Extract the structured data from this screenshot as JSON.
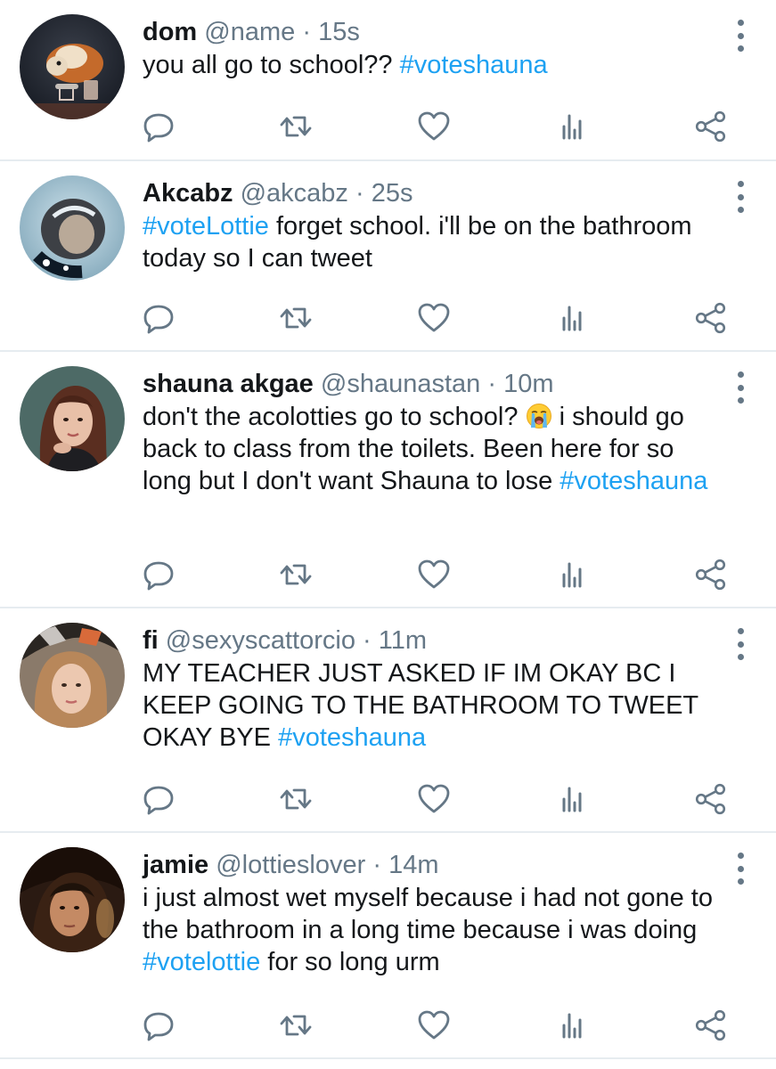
{
  "tweets": [
    {
      "name": "dom",
      "handle": "@name",
      "time": "15s",
      "avatar_icon": "avatar-guinea-pig-painting",
      "segments": [
        {
          "text": "you all go to school?? ",
          "tag": false
        },
        {
          "text": "#voteshauna",
          "tag": true
        }
      ]
    },
    {
      "name": "Akcabz",
      "handle": "@akcabz",
      "time": "25s",
      "avatar_icon": "avatar-penguin-art",
      "segments": [
        {
          "text": "#voteLottie",
          "tag": true
        },
        {
          "text": " forget school. i'll be on the bathroom today so I can tweet",
          "tag": false
        }
      ]
    },
    {
      "name": "shauna akgae",
      "handle": "@shaunastan",
      "time": "10m",
      "avatar_icon": "avatar-portrait-woman",
      "segments": [
        {
          "text": "don't the acolotties go to school? ",
          "tag": false
        },
        {
          "emoji": "loudly-crying-face-emoji"
        },
        {
          "text": " i should go back to class from the toilets. Been here for so long but I don't want Shauna to lose ",
          "tag": false
        },
        {
          "text": "#voteshauna",
          "tag": true
        }
      ]
    },
    {
      "name": "fi",
      "handle": "@sexyscattorcio",
      "time": "11m",
      "avatar_icon": "avatar-portrait-girl",
      "segments": [
        {
          "text": "MY TEACHER JUST ASKED IF IM OKAY BC I KEEP GOING TO THE BATHROOM TO TWEET OKAY BYE ",
          "tag": false
        },
        {
          "text": "#voteshauna",
          "tag": true
        }
      ]
    },
    {
      "name": "jamie",
      "handle": "@lottieslover",
      "time": "14m",
      "avatar_icon": "avatar-portrait-dark",
      "segments": [
        {
          "text": "i just almost wet myself because i had not gone to the bathroom in a long time because i was doing ",
          "tag": false
        },
        {
          "text": "#votelottie",
          "tag": true
        },
        {
          "text": " for so long urm",
          "tag": false
        }
      ]
    }
  ],
  "separator": "·",
  "action_icons": [
    "reply-icon",
    "retweet-icon",
    "like-icon",
    "analytics-icon",
    "share-icon"
  ],
  "more_icon": "more-vertical-icon",
  "colors": {
    "text": "#14171a",
    "secondary": "#657786",
    "hashtag": "#1da1f2",
    "divider": "#e6ecf0",
    "background": "#ffffff"
  }
}
